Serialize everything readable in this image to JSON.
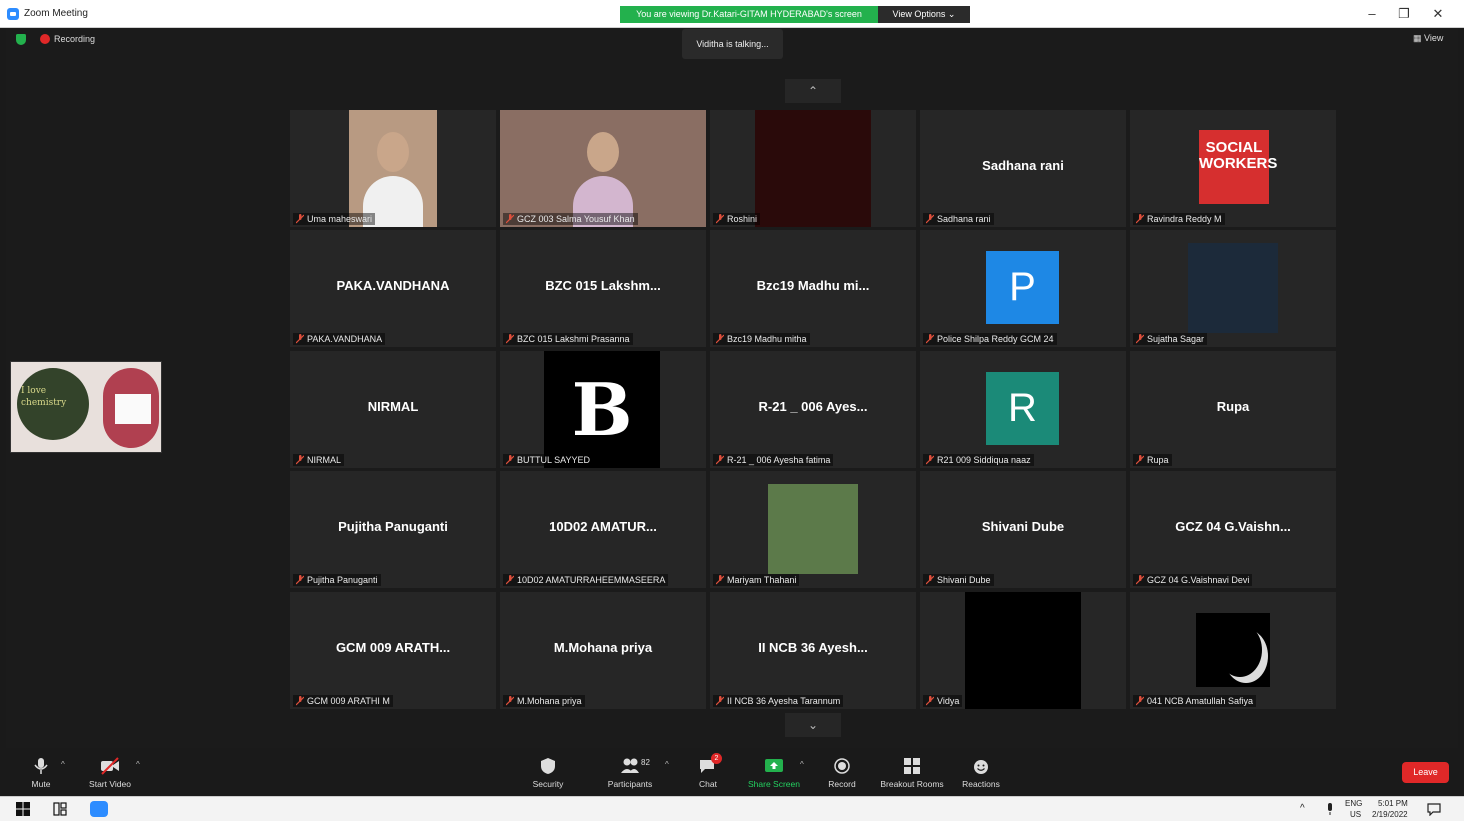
{
  "window": {
    "title": "Zoom Meeting",
    "viewing_banner": "You are viewing Dr.Katari-GITAM HYDERABAD's screen",
    "view_options": "View Options ⌄",
    "controls": [
      "–",
      "❐",
      "✕"
    ]
  },
  "meeting": {
    "recording_label": "Recording",
    "talking_indicator": "Viditha is talking...",
    "view_label": "View",
    "scroll_up": "⌃",
    "scroll_down": "⌄"
  },
  "self_view": {
    "line1": "I love",
    "line2": "chemistry"
  },
  "participants": [
    {
      "caption": "Uma maheswari",
      "display": "",
      "kind": "video",
      "color": "#b89a82"
    },
    {
      "caption": "GCZ 003 Salma Yousuf Khan",
      "display": "",
      "kind": "video",
      "color": "#8a6e63"
    },
    {
      "caption": "Roshini",
      "display": "",
      "kind": "video",
      "color": "#2a0a0a"
    },
    {
      "caption": "Sadhana rani",
      "display": "Sadhana rani",
      "kind": "name"
    },
    {
      "caption": "Ravindra Reddy M",
      "display": "SOCIAL WORKERS",
      "kind": "logo",
      "color": "#d62f2f"
    },
    {
      "caption": "PAKA.VANDHANA",
      "display": "PAKA.VANDHANA",
      "kind": "name"
    },
    {
      "caption": "BZC 015 Lakshmi Prasanna",
      "display": "BZC 015 Lakshm...",
      "kind": "name"
    },
    {
      "caption": "Bzc19 Madhu mitha",
      "display": "Bzc19 Madhu mi...",
      "kind": "name"
    },
    {
      "caption": "Police Shilpa Reddy GCM 24",
      "display": "P",
      "kind": "letter",
      "color": "#1e88e5"
    },
    {
      "caption": "Sujatha Sagar",
      "display": "",
      "kind": "avatar",
      "color": "#1c2a3a"
    },
    {
      "caption": "NIRMAL",
      "display": "NIRMAL",
      "kind": "name"
    },
    {
      "caption": "BUTTUL SAYYED",
      "display": "B",
      "kind": "blogo",
      "color": "#000000"
    },
    {
      "caption": "R-21 _ 006 Ayesha fatima",
      "display": "R-21 _ 006 Ayes...",
      "kind": "name"
    },
    {
      "caption": "R21 009 Siddiqua naaz",
      "display": "R",
      "kind": "letter",
      "color": "#1b8a78"
    },
    {
      "caption": "Rupa",
      "display": "Rupa",
      "kind": "name"
    },
    {
      "caption": "Pujitha Panuganti",
      "display": "Pujitha Panuganti",
      "kind": "name"
    },
    {
      "caption": "10D02 AMATURRAHEEMMASEERA",
      "display": "10D02  AMATUR...",
      "kind": "name"
    },
    {
      "caption": "Mariyam Thahani",
      "display": "",
      "kind": "avatar",
      "color": "#5c7a4a"
    },
    {
      "caption": "Shivani Dube",
      "display": "Shivani Dube",
      "kind": "name"
    },
    {
      "caption": "GCZ 04 G.Vaishnavi Devi",
      "display": "GCZ 04 G.Vaishn...",
      "kind": "name"
    },
    {
      "caption": "GCM 009 ARATHI M",
      "display": "GCM 009 ARATH...",
      "kind": "name"
    },
    {
      "caption": "M.Mohana priya",
      "display": "M.Mohana priya",
      "kind": "name"
    },
    {
      "caption": "II NCB 36 Ayesha Tarannum",
      "display": "II NCB 36 Ayesh...",
      "kind": "name"
    },
    {
      "caption": "Vidya",
      "display": "",
      "kind": "video",
      "color": "#000000"
    },
    {
      "caption": "041 NCB Amatullah Safiya",
      "display": "",
      "kind": "moon",
      "color": "#000000"
    }
  ],
  "toolbar": {
    "mute": "Mute",
    "start_video": "Start Video",
    "security": "Security",
    "participants": "Participants",
    "participants_count": "82",
    "chat": "Chat",
    "chat_badge": "2",
    "share_screen": "Share Screen",
    "record": "Record",
    "breakout_rooms": "Breakout Rooms",
    "reactions": "Reactions",
    "leave": "Leave",
    "caret": "^"
  },
  "taskbar": {
    "tray_caret": "^",
    "lang_top": "ENG",
    "lang_bottom": "US",
    "time": "5:01 PM",
    "date": "2/19/2022"
  },
  "colors": {
    "accent_green": "#23b14d",
    "leave_red": "#e02828",
    "zoom_blue": "#2d8cff",
    "tile_bg": "#262626"
  }
}
